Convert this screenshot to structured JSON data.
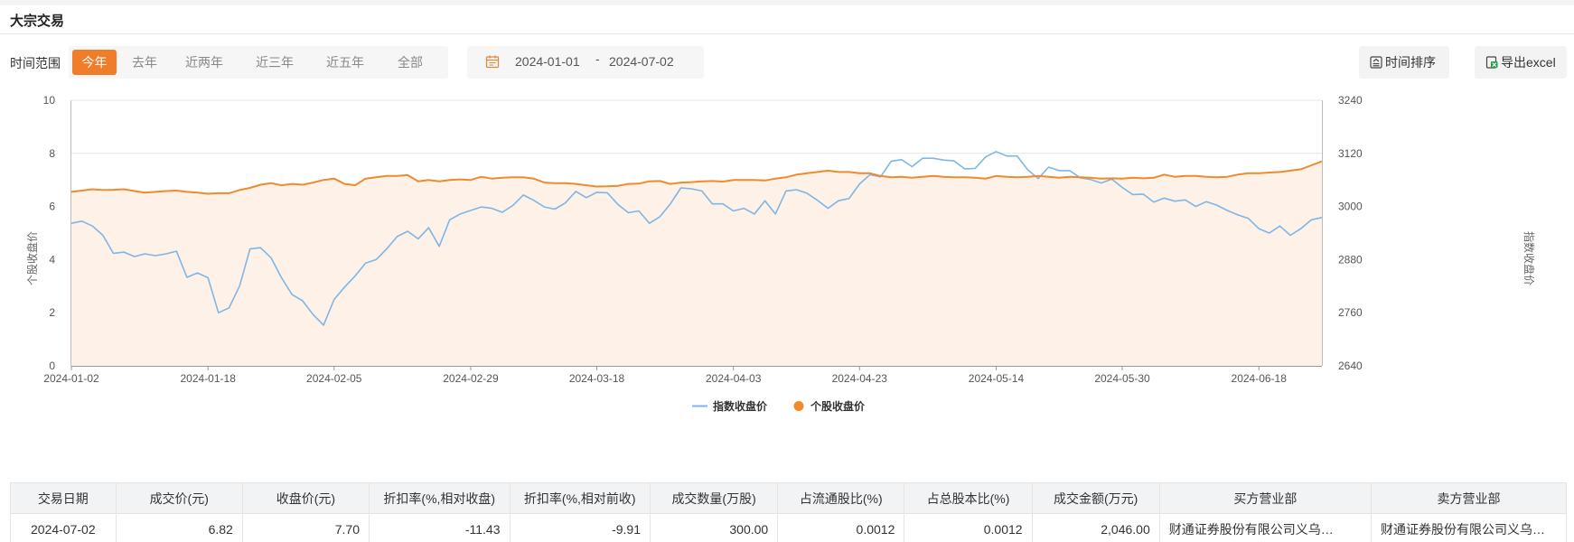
{
  "section_title": "大宗交易",
  "filter": {
    "range_label": "时间范围",
    "tabs": [
      "今年",
      "去年",
      "近两年",
      "近三年",
      "近五年",
      "全部"
    ],
    "active_tab": 0
  },
  "date_range": {
    "start": "2024-01-01",
    "separator": "-",
    "end": "2024-07-02"
  },
  "toolbar": {
    "sort_label": "时间排序",
    "export_label": "导出excel"
  },
  "colors": {
    "accent": "#f07d2a",
    "index_line": "#7eb6e6",
    "stock_line": "#f08a2d",
    "area_fill": "#fdf1e8"
  },
  "chart_data": {
    "type": "line",
    "x_ticks": [
      "2024-01-02",
      "2024-01-18",
      "2024-02-05",
      "2024-02-29",
      "2024-03-18",
      "2024-04-03",
      "2024-04-23",
      "2024-05-14",
      "2024-05-30",
      "2024-06-18"
    ],
    "ylabel_left": "个股收盘价",
    "ylabel_right": "指数收盘价",
    "ylim_left": [
      0,
      10
    ],
    "yticks_left": [
      0,
      2,
      4,
      6,
      8,
      10
    ],
    "ylim_right": [
      2640,
      3240
    ],
    "yticks_right": [
      2640,
      2760,
      2880,
      3000,
      3120,
      3240
    ],
    "grid": true,
    "legend_position": "bottom-center",
    "series": [
      {
        "name": "指数收盘价",
        "axis": "right",
        "values": [
          2962,
          2967,
          2956,
          2935,
          2894,
          2897,
          2887,
          2893,
          2889,
          2893,
          2899,
          2840,
          2850,
          2839,
          2760,
          2771,
          2820,
          2904,
          2907,
          2884,
          2839,
          2801,
          2787,
          2756,
          2732,
          2790,
          2818,
          2843,
          2872,
          2880,
          2904,
          2932,
          2944,
          2927,
          2952,
          2910,
          2970,
          2983,
          2991,
          2999,
          2996,
          2987,
          3002,
          3026,
          3014,
          2999,
          2994,
          3008,
          3034,
          3020,
          3032,
          3031,
          3005,
          2986,
          2990,
          2962,
          2977,
          3006,
          3042,
          3040,
          3035,
          3006,
          3006,
          2990,
          2996,
          2983,
          3013,
          2983,
          3035,
          3038,
          3030,
          3014,
          2996,
          3013,
          3018,
          3051,
          3072,
          3067,
          3102,
          3106,
          3090,
          3109,
          3109,
          3105,
          3103,
          3085,
          3086,
          3112,
          3124,
          3114,
          3114,
          3083,
          3063,
          3089,
          3081,
          3081,
          3065,
          3061,
          3053,
          3062,
          3043,
          3027,
          3028,
          3010,
          3019,
          3012,
          3015,
          3000,
          3011,
          3003,
          2991,
          2981,
          2973,
          2950,
          2940,
          2956,
          2935,
          2950,
          2970,
          2975
        ]
      },
      {
        "name": "个股收盘价",
        "axis": "left",
        "values": [
          6.55,
          6.6,
          6.65,
          6.62,
          6.63,
          6.65,
          6.58,
          6.52,
          6.55,
          6.58,
          6.6,
          6.55,
          6.52,
          6.48,
          6.5,
          6.5,
          6.62,
          6.7,
          6.82,
          6.88,
          6.8,
          6.85,
          6.82,
          6.9,
          7.0,
          7.05,
          6.85,
          6.8,
          7.05,
          7.1,
          7.15,
          7.15,
          7.18,
          6.95,
          7.0,
          6.95,
          7.0,
          7.02,
          7.0,
          7.12,
          7.05,
          7.08,
          7.1,
          7.1,
          7.05,
          6.9,
          6.88,
          6.88,
          6.85,
          6.8,
          6.75,
          6.76,
          6.78,
          6.85,
          6.86,
          6.95,
          6.96,
          6.85,
          6.9,
          6.92,
          6.95,
          6.96,
          6.94,
          7.0,
          7.0,
          7.0,
          6.98,
          7.05,
          7.1,
          7.2,
          7.25,
          7.3,
          7.35,
          7.3,
          7.3,
          7.25,
          7.25,
          7.15,
          7.1,
          7.12,
          7.08,
          7.12,
          7.15,
          7.12,
          7.1,
          7.1,
          7.08,
          7.05,
          7.15,
          7.12,
          7.1,
          7.12,
          7.15,
          7.12,
          7.08,
          7.12,
          7.1,
          7.08,
          7.05,
          7.06,
          7.05,
          7.08,
          7.06,
          7.08,
          7.2,
          7.12,
          7.15,
          7.15,
          7.12,
          7.1,
          7.12,
          7.2,
          7.25,
          7.25,
          7.28,
          7.3,
          7.35,
          7.4,
          7.55,
          7.7
        ]
      }
    ]
  },
  "table": {
    "columns": [
      "交易日期",
      "成交价(元)",
      "收盘价(元)",
      "折扣率(%,相对收盘)",
      "折扣率(%,相对前收)",
      "成交数量(万股)",
      "占流通股比(%)",
      "占总股本比(%)",
      "成交金额(万元)",
      "买方营业部",
      "卖方营业部"
    ],
    "rows": [
      [
        "2024-07-02",
        "6.82",
        "7.70",
        "-11.43",
        "-9.91",
        "300.00",
        "0.0012",
        "0.0012",
        "2,046.00",
        "财通证券股份有限公司义乌…",
        "财通证券股份有限公司义乌…"
      ]
    ]
  }
}
